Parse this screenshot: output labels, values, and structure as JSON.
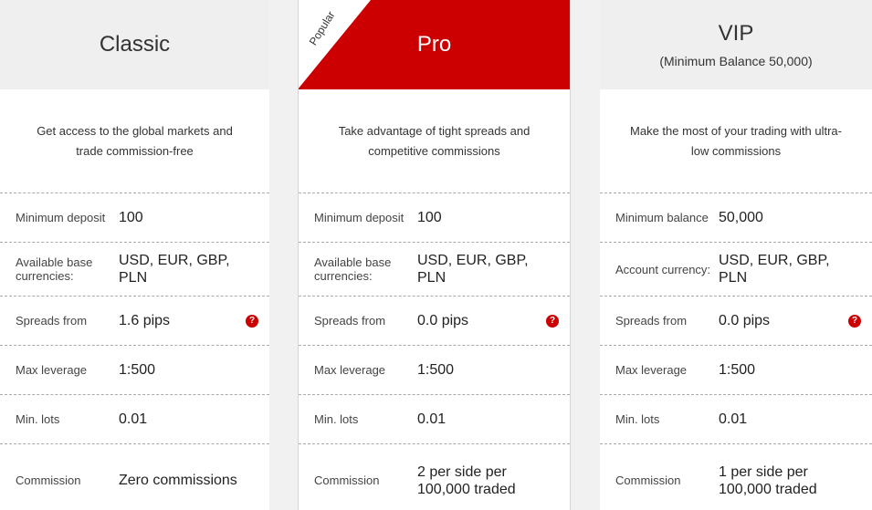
{
  "plans": [
    {
      "name": "Classic",
      "subtitle": "",
      "description": "Get access to the global markets and trade commission-free",
      "rows": [
        {
          "label": "Minimum deposit",
          "value": "100"
        },
        {
          "label": "Available base currencies:",
          "value": "USD, EUR, GBP, PLN"
        },
        {
          "label": "Spreads from",
          "value": "1.6 pips",
          "help": "?"
        },
        {
          "label": "Max leverage",
          "value": "1:500"
        },
        {
          "label": "Min. lots",
          "value": "0.01"
        },
        {
          "label": "Commission",
          "value": "Zero commissions"
        }
      ]
    },
    {
      "name": "Pro",
      "badge": "Popular",
      "description": "Take advantage of tight spreads and competitive commissions",
      "rows": [
        {
          "label": "Minimum deposit",
          "value": "100"
        },
        {
          "label": "Available base currencies:",
          "value": "USD, EUR, GBP, PLN"
        },
        {
          "label": "Spreads from",
          "value": "0.0 pips",
          "help": "?"
        },
        {
          "label": "Max leverage",
          "value": "1:500"
        },
        {
          "label": "Min. lots",
          "value": "0.01"
        },
        {
          "label": "Commission",
          "value": "2 per side per 100,000 traded"
        }
      ]
    },
    {
      "name": "VIP",
      "subtitle": "(Minimum Balance 50,000)",
      "description": "Make the most of your trading with ultra-low commissions",
      "rows": [
        {
          "label": "Minimum balance",
          "value": "50,000"
        },
        {
          "label": "Account currency:",
          "value": "USD, EUR, GBP, PLN"
        },
        {
          "label": "Spreads from",
          "value": "0.0 pips",
          "help": "?"
        },
        {
          "label": "Max leverage",
          "value": "1:500"
        },
        {
          "label": "Min. lots",
          "value": "0.01"
        },
        {
          "label": "Commission",
          "value": "1 per side per 100,000 traded"
        }
      ]
    }
  ],
  "colors": {
    "accent": "#cc0000",
    "header_bg": "#efefef",
    "page_bg": "#f1f1f1"
  }
}
